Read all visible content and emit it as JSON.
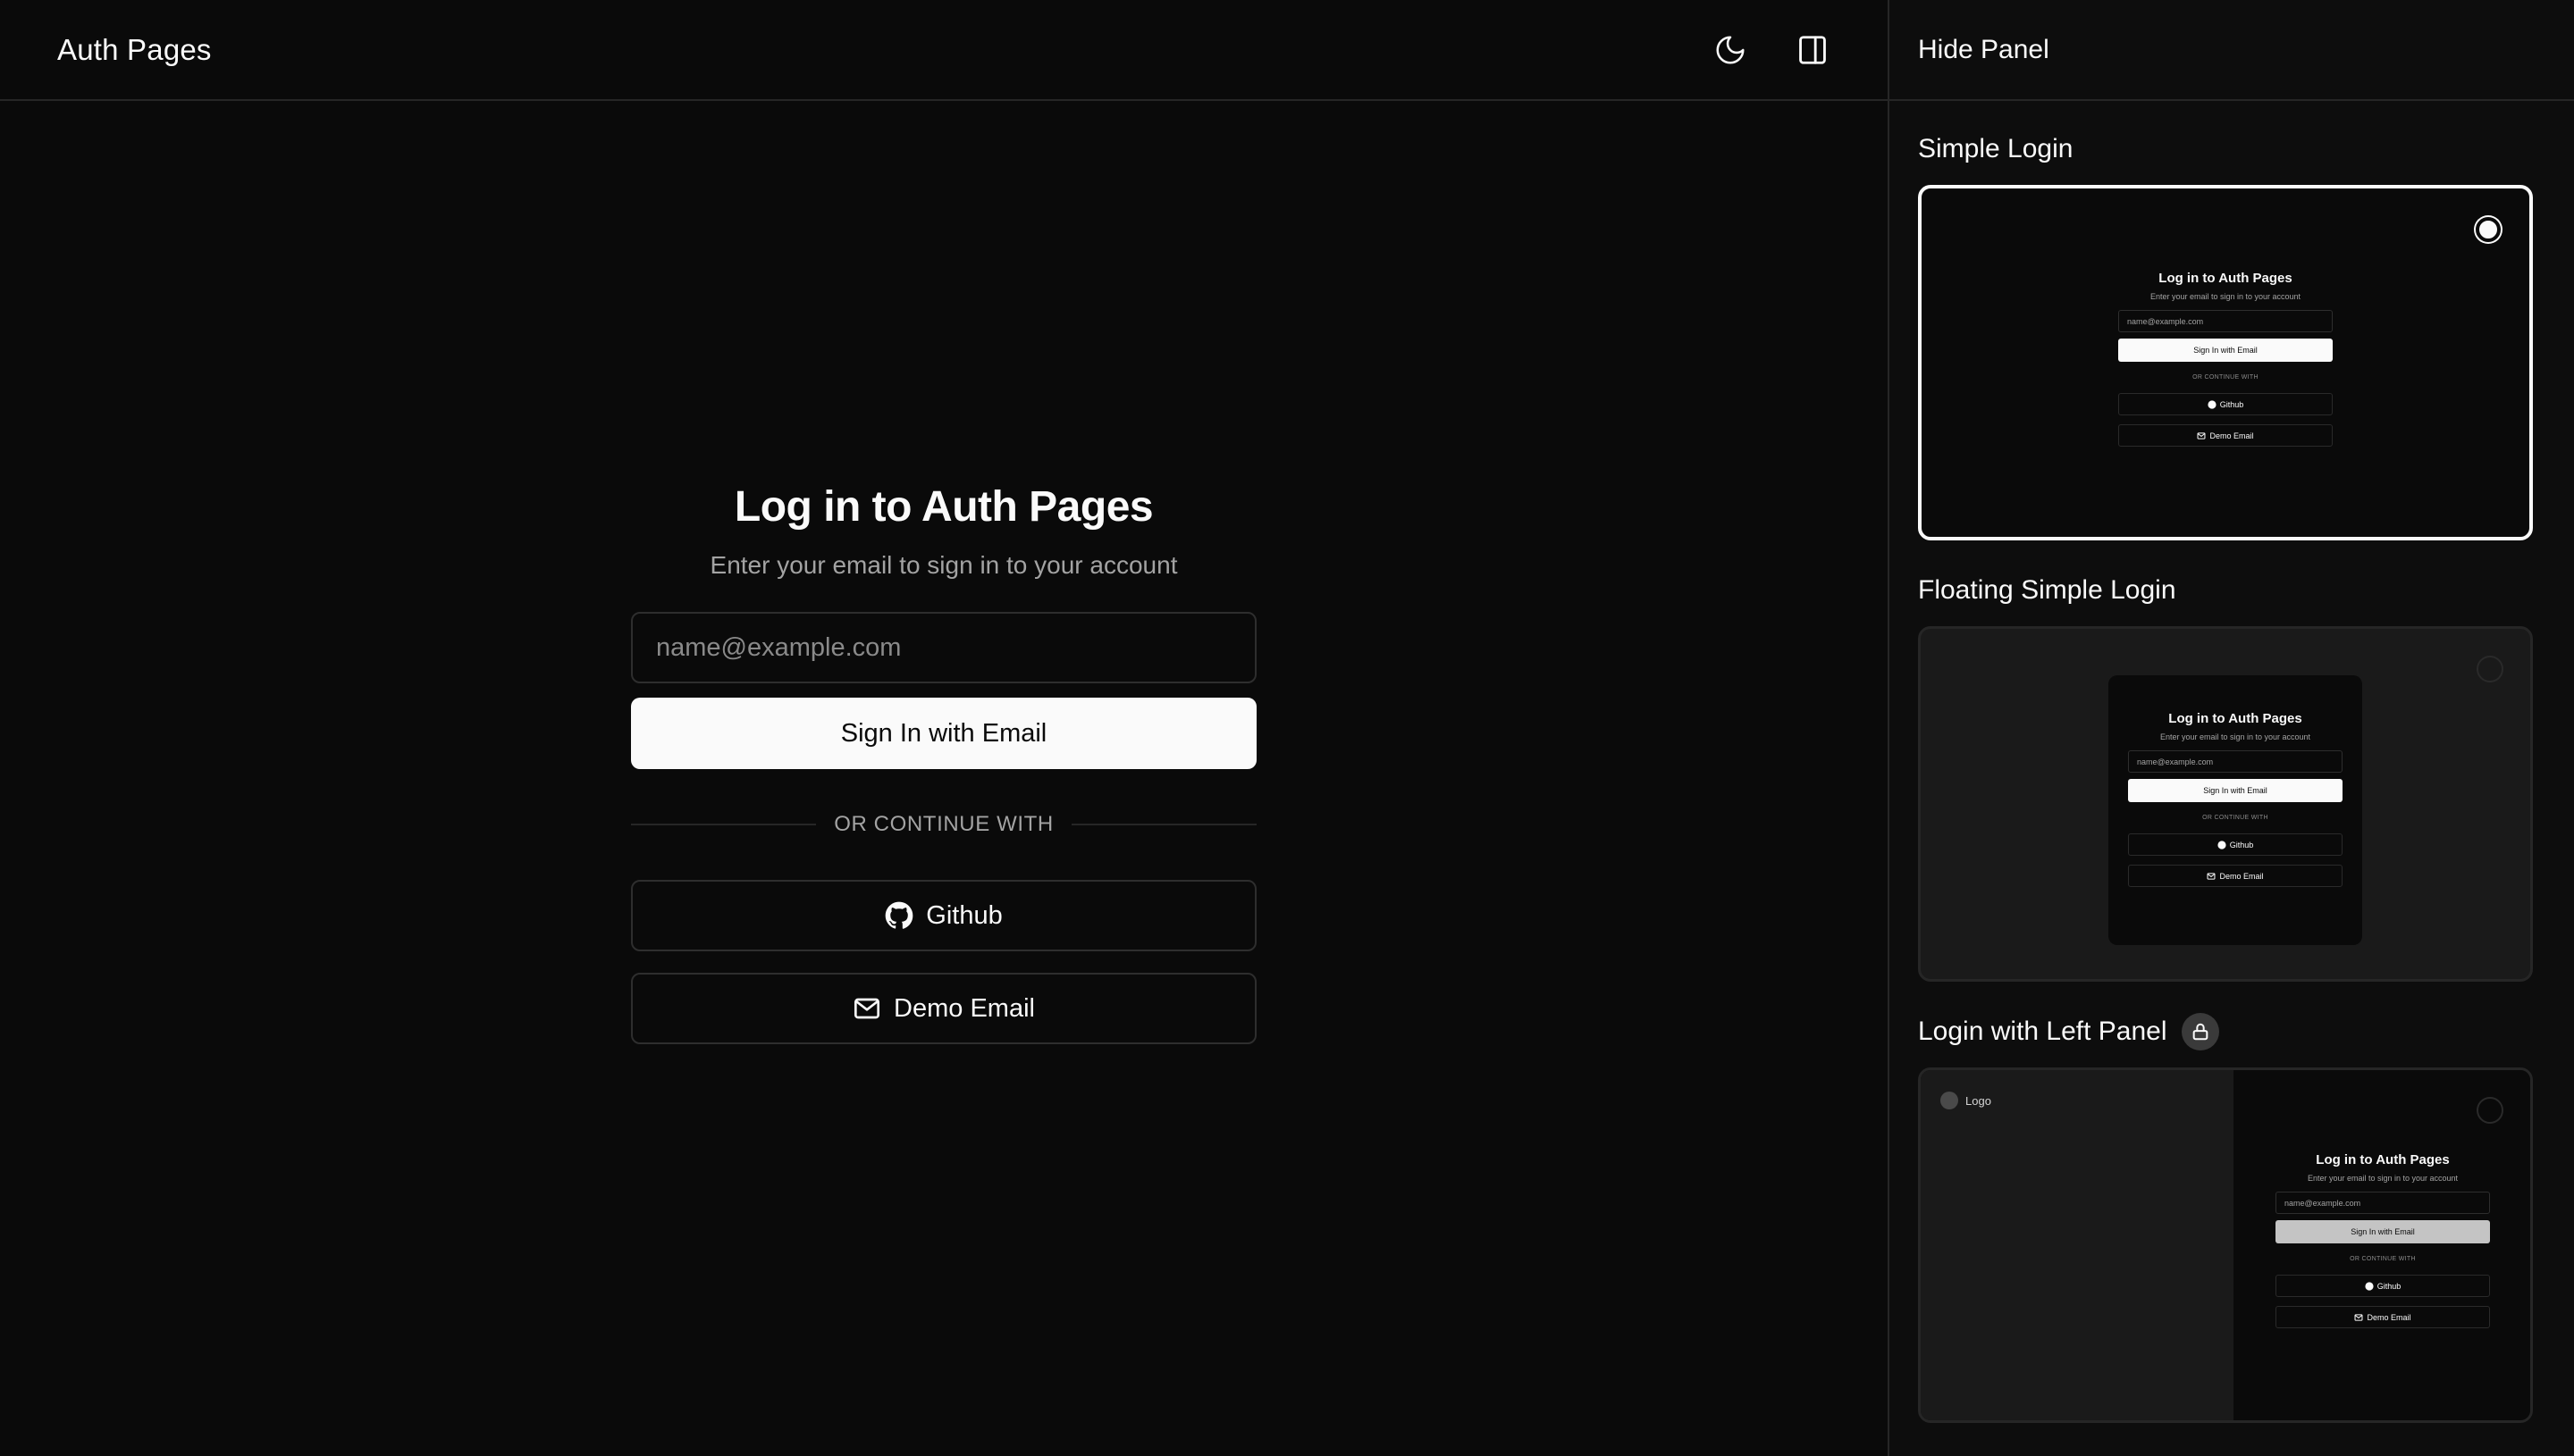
{
  "header": {
    "app_title": "Auth Pages",
    "theme_toggle_icon": "moon-icon",
    "panel_toggle_icon": "panel-right-icon"
  },
  "login": {
    "title": "Log in to Auth Pages",
    "subtitle": "Enter your email to sign in to your account",
    "email_placeholder": "name@example.com",
    "email_value": "",
    "primary_button": "Sign In with Email",
    "divider": "OR CONTINUE WITH",
    "github_button": "Github",
    "demo_email_button": "Demo Email"
  },
  "panel": {
    "hide_label": "Hide Panel",
    "templates": [
      {
        "label": "Simple Login",
        "selected": true,
        "locked": false
      },
      {
        "label": "Floating Simple Login",
        "selected": false,
        "locked": false
      },
      {
        "label": "Login with Left Panel",
        "selected": false,
        "locked": true
      }
    ],
    "preview": {
      "title": "Log in to Auth Pages",
      "subtitle": "Enter your email to sign in to your account",
      "email_placeholder": "name@example.com",
      "primary_button": "Sign In with Email",
      "divider": "OR CONTINUE WITH",
      "github_button": "Github",
      "demo_email_button": "Demo Email",
      "logo_label": "Logo"
    }
  },
  "colors": {
    "background": "#0a0a0a",
    "foreground": "#fafafa",
    "muted": "#a3a3a3",
    "border": "#262626"
  }
}
